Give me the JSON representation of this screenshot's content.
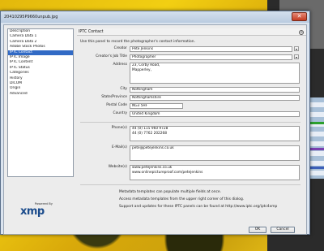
{
  "window": {
    "title": "20410295P9660unpub.jpg",
    "close_glyph": "✕"
  },
  "sidebar": {
    "items": [
      {
        "label": "Description",
        "selected": false
      },
      {
        "label": "Camera Data 1",
        "selected": false
      },
      {
        "label": "Camera Data 2",
        "selected": false
      },
      {
        "label": "Adobe Stock Photos",
        "selected": false
      },
      {
        "label": "IPTC Contact",
        "selected": true
      },
      {
        "label": "IPTC Image",
        "selected": false
      },
      {
        "label": "IPTC Content",
        "selected": false
      },
      {
        "label": "IPTC Status",
        "selected": false
      },
      {
        "label": "Categories",
        "selected": false
      },
      {
        "label": "History",
        "selected": false
      },
      {
        "label": "DICOM",
        "selected": false
      },
      {
        "label": "Origin",
        "selected": false
      },
      {
        "label": "Advanced",
        "selected": false
      }
    ]
  },
  "panel": {
    "title": "IPTC Contact",
    "menu_icon": "circle-arrow-icon",
    "description": "Use this panel to record the photographer's contact information.",
    "fields": {
      "creator": {
        "label": "Creator",
        "value": "Pete Jenkins"
      },
      "job_title": {
        "label": "Creator's Job Title",
        "value": "Photographer"
      },
      "address": {
        "label": "Address",
        "value": "23, Corby Road,\nMapperley,"
      },
      "city": {
        "label": "City",
        "value": "Nottingham"
      },
      "state": {
        "label": "State/Province",
        "value": "Nottinghamshire"
      },
      "postal": {
        "label": "Postal Code",
        "value": "NG3 5HF"
      },
      "country": {
        "label": "Country",
        "value": "United Kingdom"
      },
      "phones": {
        "label": "Phone(s)",
        "value": "44 (0) 115 960 9728\n44 (0) 7762 202268"
      },
      "emails": {
        "label": "E-Mail(s)",
        "value": "pete@petejenkins.co.uk"
      },
      "websites": {
        "label": "Website(s)",
        "value": "www.petejenkins.co.uk\nwww.onlinepictureproof.com/petejenkins"
      }
    },
    "info_lines": [
      "Metadata templates can populate multiple fields at once.",
      "Access metadata templates from the upper right corner of this dialog.",
      "Support and updates for these IPTC panels can be found at http://www.iptc.org/iptc4xmp"
    ]
  },
  "logo": {
    "powered_by": "Powered By",
    "brand": "xmp"
  },
  "buttons": {
    "ok": "OK",
    "cancel": "Cancel"
  },
  "colors": {
    "selection": "#316ac5",
    "close_button": "#c43b22",
    "xmp_brand": "#1c4c8c"
  }
}
